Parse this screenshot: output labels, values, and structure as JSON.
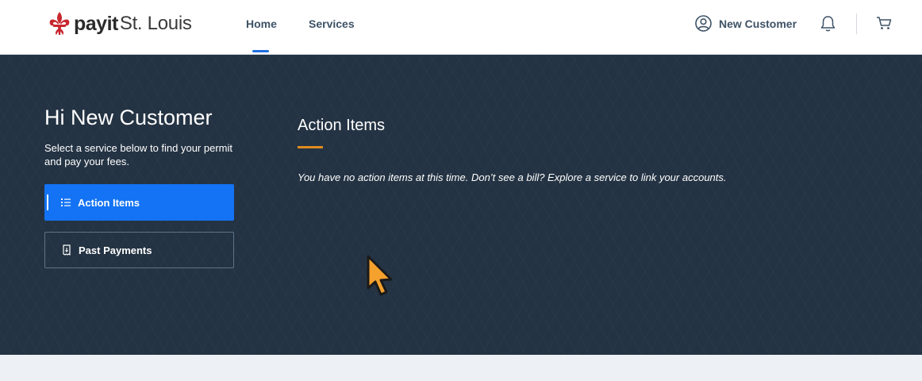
{
  "header": {
    "logo": {
      "brand": "payit",
      "city": "St. Louis",
      "icon": "fleur-de-lis-icon"
    },
    "nav": [
      {
        "label": "Home",
        "active": true
      },
      {
        "label": "Services",
        "active": false
      }
    ],
    "user": {
      "name": "New Customer",
      "icon": "user-circle-icon"
    },
    "notifications_icon": "bell-icon",
    "cart_icon": "cart-icon"
  },
  "sidebar": {
    "greeting": "Hi New Customer",
    "subtitle": "Select a service below to find your permit and pay your fees.",
    "items": [
      {
        "label": "Action Items",
        "icon": "list-icon",
        "active": true
      },
      {
        "label": "Past Payments",
        "icon": "receipt-icon",
        "active": false
      }
    ]
  },
  "main": {
    "title": "Action Items",
    "empty_message": "You have no action items at this time. Don’t see a bill? Explore a service to link your accounts."
  },
  "colors": {
    "hero_bg": "#243343",
    "accent_blue": "#1373f4",
    "accent_orange": "#e08b1f",
    "nav_text": "#3d5266",
    "footer_bg": "#edf0f4",
    "logo_red": "#c8272e"
  }
}
